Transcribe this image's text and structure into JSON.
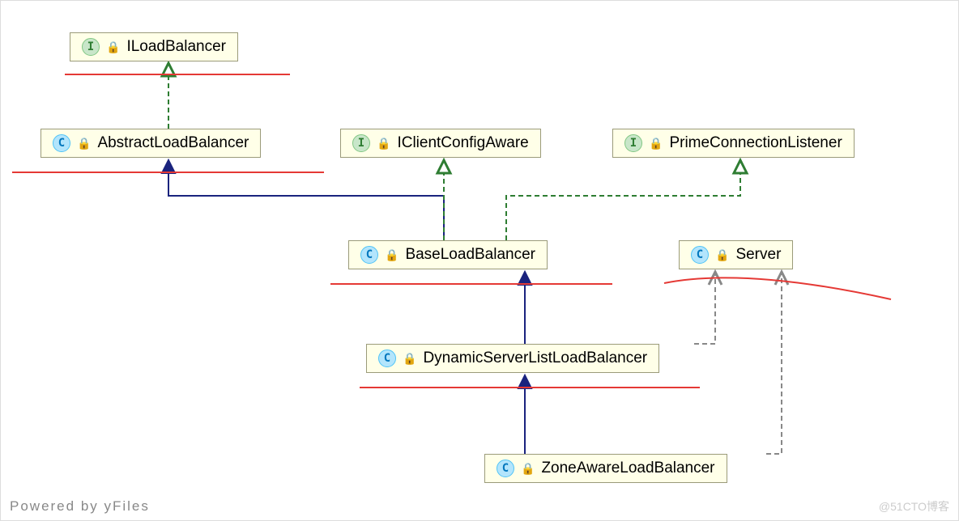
{
  "nodes": {
    "iloadbalancer": {
      "label": "ILoadBalancer",
      "type": "I"
    },
    "abstractloadbalancer": {
      "label": "AbstractLoadBalancer",
      "type": "C"
    },
    "iclientconfigaware": {
      "label": "IClientConfigAware",
      "type": "I"
    },
    "primeconnectionlistener": {
      "label": "PrimeConnectionListener",
      "type": "I"
    },
    "baseloadbalancer": {
      "label": "BaseLoadBalancer",
      "type": "C"
    },
    "server": {
      "label": "Server",
      "type": "C"
    },
    "dynamicserverlistloadbalancer": {
      "label": "DynamicServerListLoadBalancer",
      "type": "C"
    },
    "zoneawareloadbalancer": {
      "label": "ZoneAwareLoadBalancer",
      "type": "C"
    }
  },
  "footer": {
    "powered": "Powered by yFiles",
    "watermark": "@51CTO博客"
  },
  "icons": {
    "interface": "I",
    "class": "C"
  }
}
